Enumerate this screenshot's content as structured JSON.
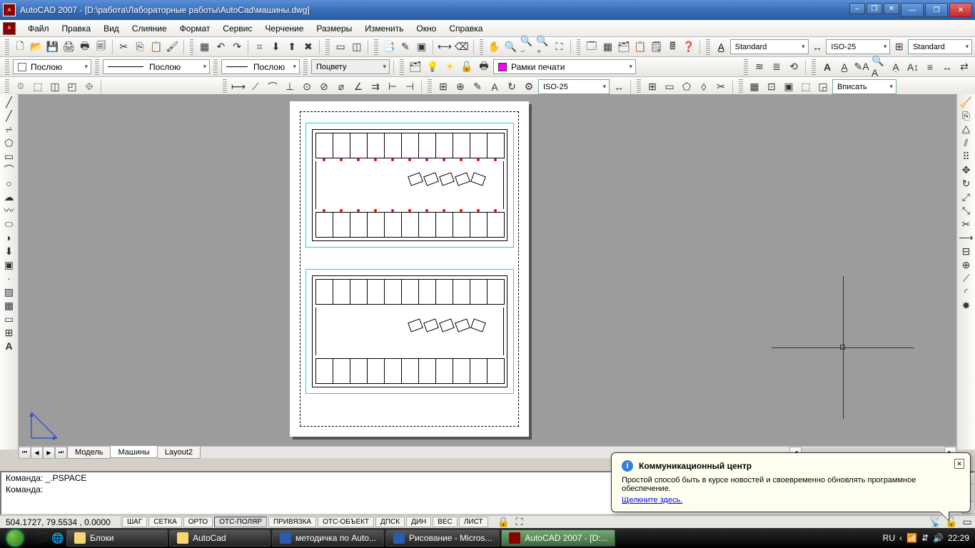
{
  "title": "AutoCAD 2007 - [D:\\работа\\Лабораторные работы\\AutoCad\\машины.dwg]",
  "menu": {
    "file": "Файл",
    "edit": "Правка",
    "view": "Вид",
    "merge": "Слияние",
    "format": "Формат",
    "service": "Сервис",
    "draw": "Черчение",
    "dims": "Размеры",
    "modify": "Изменить",
    "window": "Окно",
    "help": "Справка"
  },
  "styles": {
    "text": "Standard",
    "dim": "ISO-25",
    "table": "Standard",
    "dim2": "ISO-25",
    "fit": "Вписать"
  },
  "layer": {
    "bylayer": "Послою",
    "bycolor": "Поцвету",
    "frames": "Рамки печати"
  },
  "tabs": {
    "model": "Модель",
    "t1": "Машины",
    "t2": "Layout2"
  },
  "cmd": {
    "l1": "Команда: _.PSPACE",
    "l2": "Команда:"
  },
  "status": {
    "coords": "504.1727, 79.5534 , 0.0000",
    "snap": "ШАГ",
    "grid": "СЕТКА",
    "ortho": "ОРТО",
    "polar": "ОТС-ПОЛЯР",
    "osnap": "ПРИВЯЗКА",
    "otrack": "ОТС-ОБЪЕКТ",
    "ducs": "ДПСК",
    "dyn": "ДИН",
    "wt": "ВЕС",
    "paper": "ЛИСТ"
  },
  "balloon": {
    "title": "Коммуникационный центр",
    "text": "Простой способ быть в курсе новостей и своевременно обновлять программное обеспечение.",
    "link": "Щелкните здесь."
  },
  "taskbar": {
    "t1": "Блоки",
    "t2": "AutoCad",
    "t3": "методичка по Auto...",
    "t4": "Рисование - Micros...",
    "t5": "AutoCAD 2007 - [D:...",
    "lang": "RU",
    "clock": "22:29"
  }
}
